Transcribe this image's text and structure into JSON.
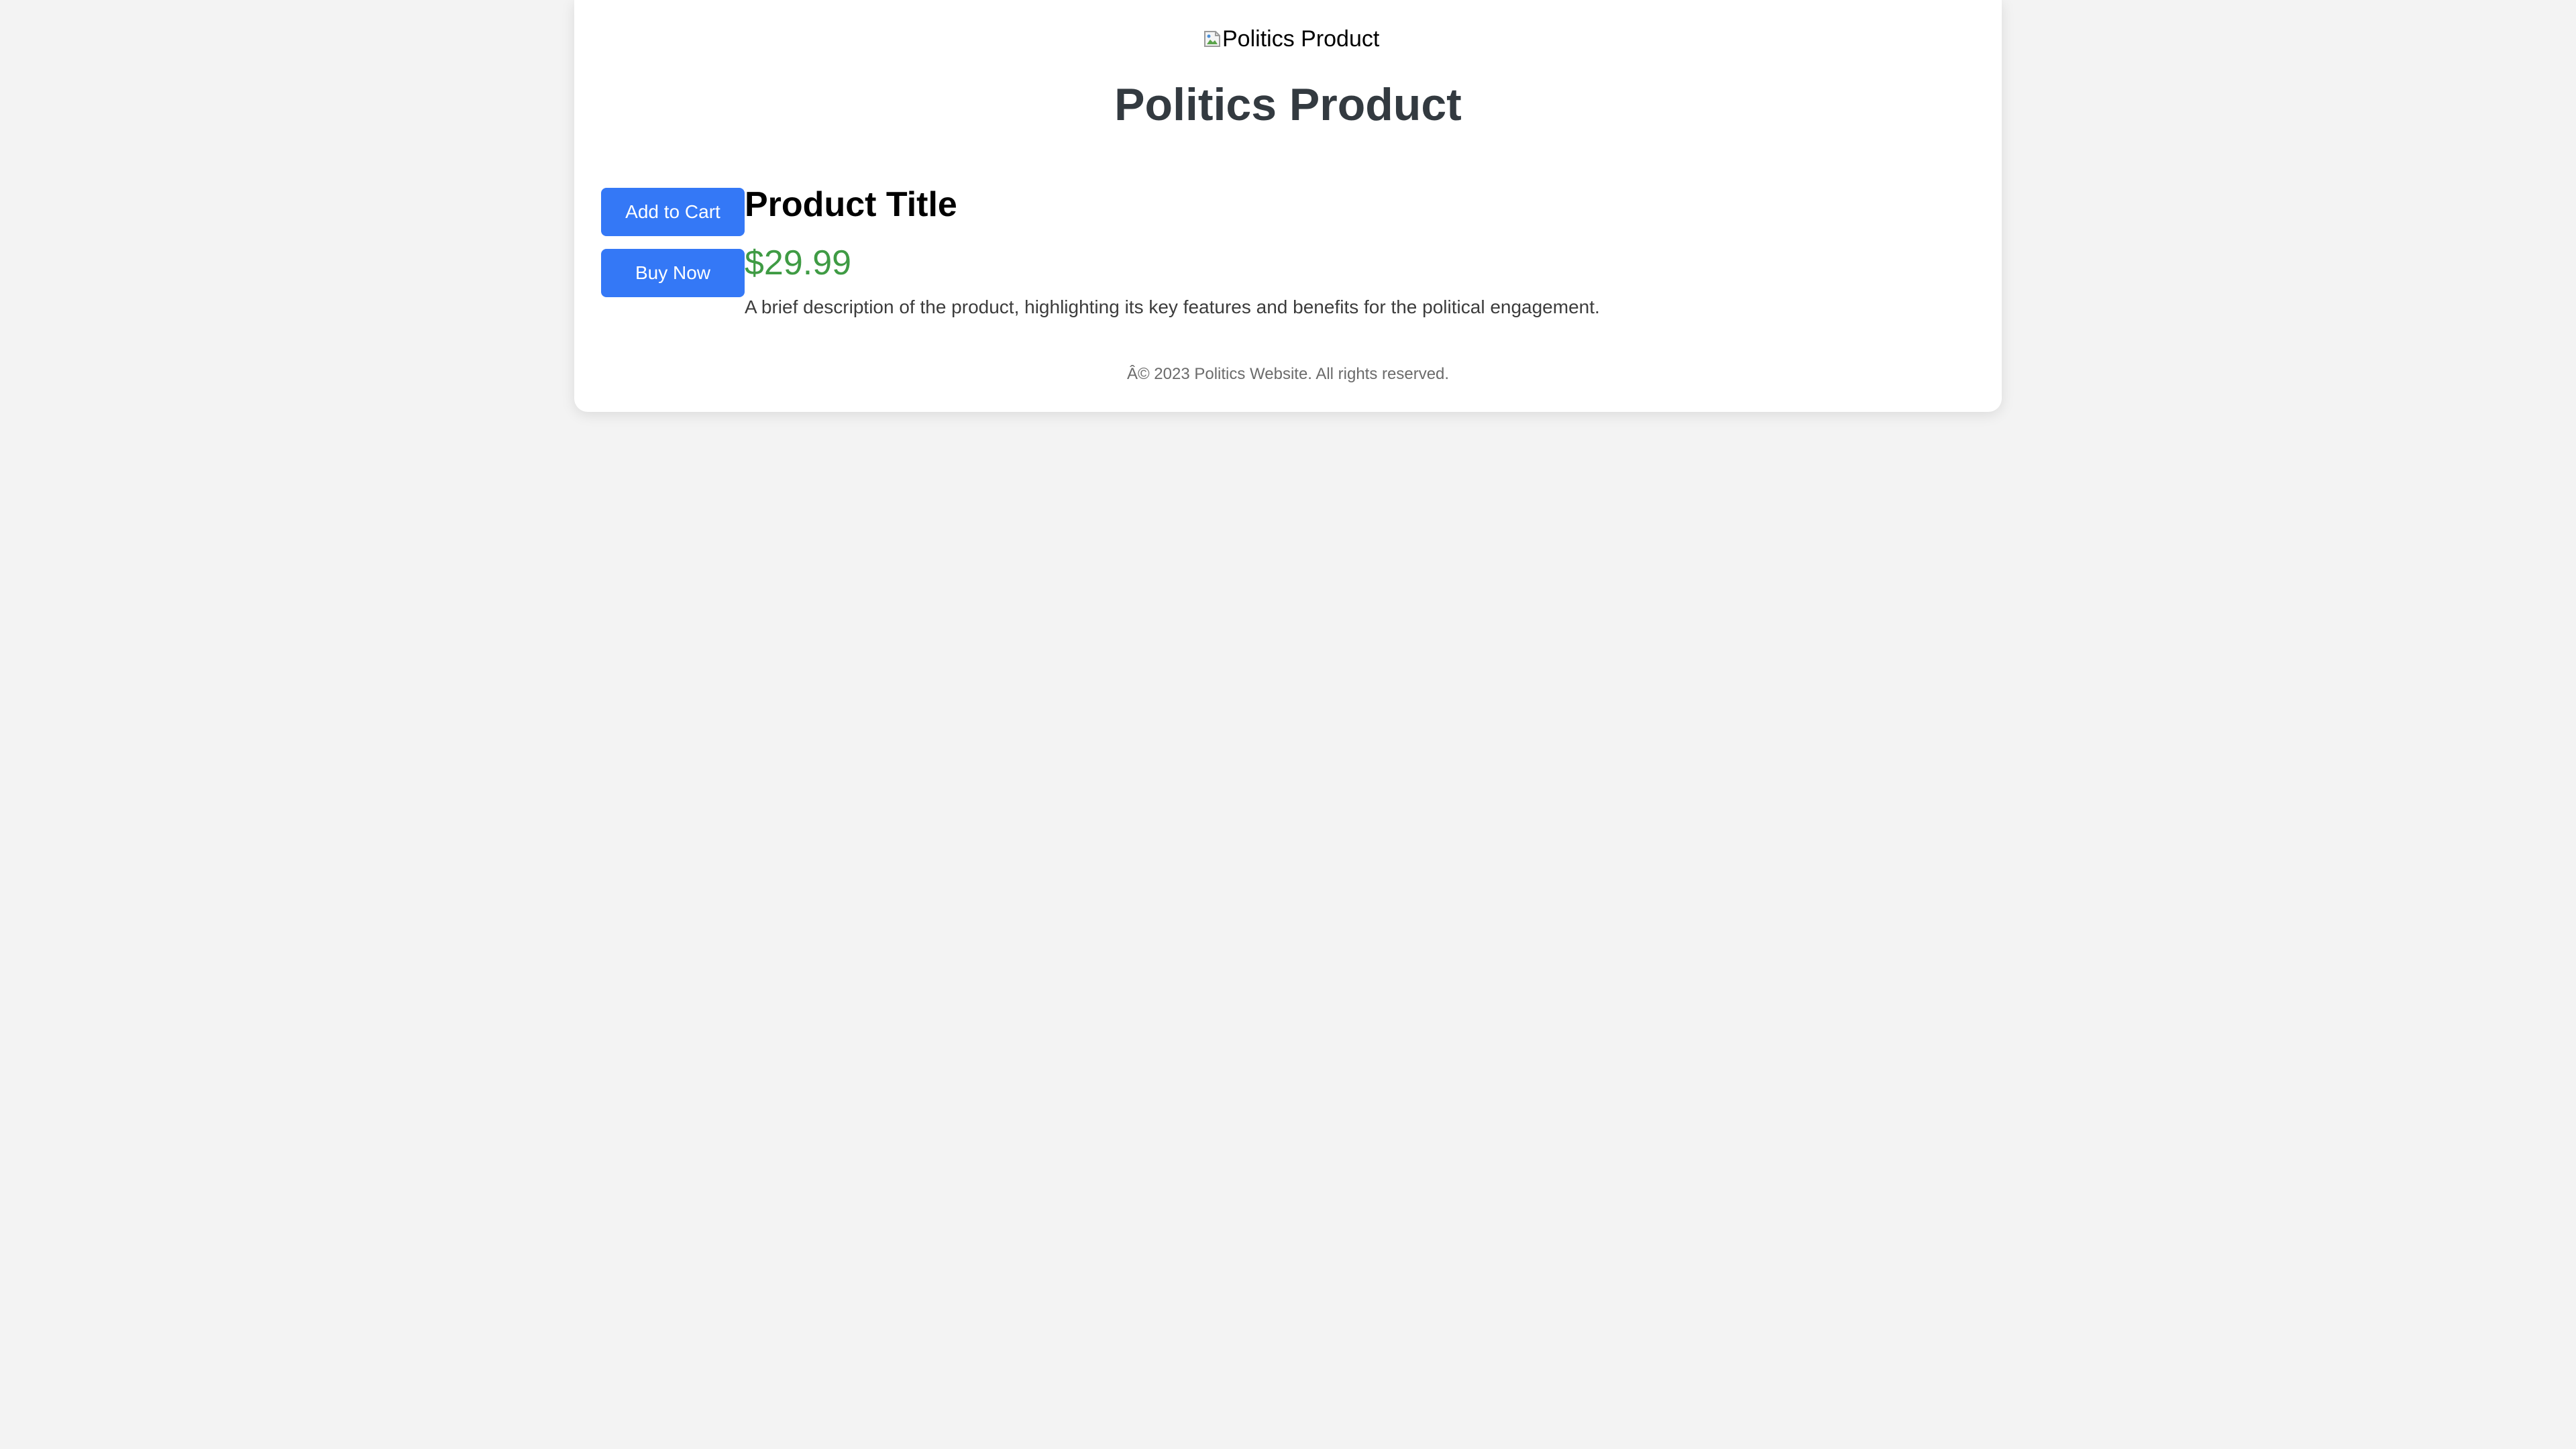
{
  "header": {
    "image_alt": "Politics Product",
    "title": "Politics Product"
  },
  "actions": {
    "add_to_cart_label": "Add to Cart",
    "buy_now_label": "Buy Now"
  },
  "product": {
    "title": "Product Title",
    "price": "$29.99",
    "description": "A brief description of the product, highlighting its key features and benefits for the political engagement."
  },
  "footer": {
    "text": "Â© 2023 Politics Website. All rights reserved."
  },
  "colors": {
    "background": "#f3f3f3",
    "button": "#3478f6",
    "price": "#3f9b44",
    "title": "#333a40"
  },
  "icons": {
    "image_placeholder": "broken-image-icon"
  }
}
